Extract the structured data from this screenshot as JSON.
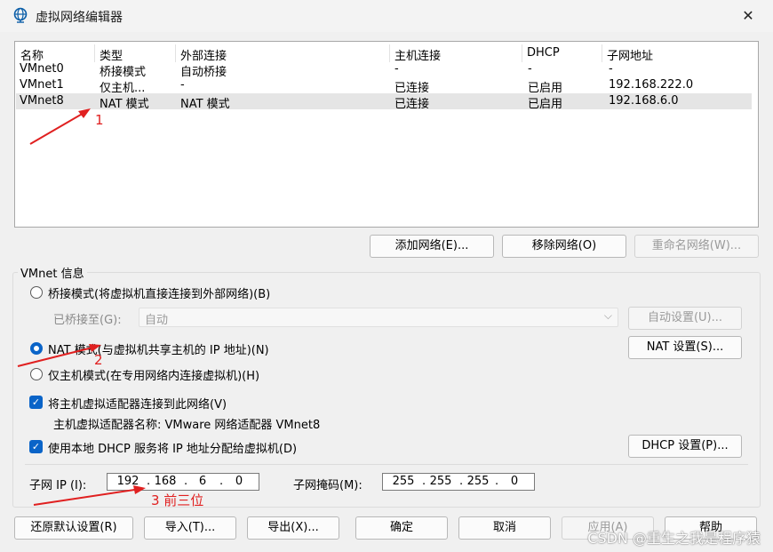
{
  "window": {
    "title": "虚拟网络编辑器",
    "close_glyph": "✕"
  },
  "table": {
    "headers": [
      "名称",
      "类型",
      "外部连接",
      "主机连接",
      "DHCP",
      "子网地址"
    ],
    "rows": [
      [
        "VMnet0",
        "桥接模式",
        "自动桥接",
        "-",
        "-",
        "-"
      ],
      [
        "VMnet1",
        "仅主机...",
        "-",
        "已连接",
        "已启用",
        "192.168.222.0"
      ],
      [
        "VMnet8",
        "NAT 模式",
        "NAT 模式",
        "已连接",
        "已启用",
        "192.168.6.0"
      ]
    ],
    "selected_row": 2
  },
  "list_buttons": {
    "add": "添加网络(E)...",
    "remove": "移除网络(O)",
    "rename": "重命名网络(W)..."
  },
  "vmnet_info": {
    "group_label": "VMnet 信息",
    "bridge_radio": "桥接模式(将虚拟机直接连接到外部网络)(B)",
    "bridged_to_label": "已桥接至(G):",
    "bridged_to_value": "自动",
    "auto_settings": "自动设置(U)...",
    "nat_radio": "NAT 模式(与虚拟机共享主机的 IP 地址)(N)",
    "nat_settings": "NAT 设置(S)...",
    "host_only_radio": "仅主机模式(在专用网络内连接虚拟机)(H)",
    "connect_adapter": "将主机虚拟适配器连接到此网络(V)",
    "adapter_name": "主机虚拟适配器名称: VMware 网络适配器 VMnet8",
    "use_dhcp": "使用本地 DHCP 服务将 IP 地址分配给虚拟机(D)",
    "dhcp_settings": "DHCP 设置(P)...",
    "subnet_ip_label": "子网 IP (I):",
    "subnet_ip": [
      "192",
      "168",
      "6",
      "0"
    ],
    "subnet_mask_label": "子网掩码(M):",
    "subnet_mask": [
      "255",
      "255",
      "255",
      "0"
    ]
  },
  "bottom_buttons": {
    "restore": "还原默认设置(R)",
    "import": "导入(T)...",
    "export": "导出(X)...",
    "ok": "确定",
    "cancel": "取消",
    "apply": "应用(A)",
    "help": "帮助"
  },
  "annotations": {
    "a1": "1",
    "a2": "2",
    "a3": "3  前三位"
  },
  "watermark": "CSDN @重生之我是程序猿",
  "colors": {
    "accent": "#0a64c8",
    "annotation": "#e02020"
  }
}
